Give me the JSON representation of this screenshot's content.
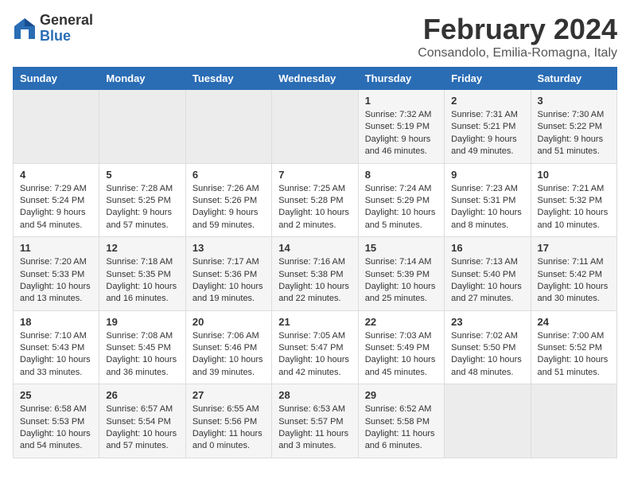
{
  "header": {
    "logo_general": "General",
    "logo_blue": "Blue",
    "month": "February 2024",
    "location": "Consandolo, Emilia-Romagna, Italy"
  },
  "days_of_week": [
    "Sunday",
    "Monday",
    "Tuesday",
    "Wednesday",
    "Thursday",
    "Friday",
    "Saturday"
  ],
  "weeks": [
    [
      {
        "day": "",
        "info": ""
      },
      {
        "day": "",
        "info": ""
      },
      {
        "day": "",
        "info": ""
      },
      {
        "day": "",
        "info": ""
      },
      {
        "day": "1",
        "info": "Sunrise: 7:32 AM\nSunset: 5:19 PM\nDaylight: 9 hours\nand 46 minutes."
      },
      {
        "day": "2",
        "info": "Sunrise: 7:31 AM\nSunset: 5:21 PM\nDaylight: 9 hours\nand 49 minutes."
      },
      {
        "day": "3",
        "info": "Sunrise: 7:30 AM\nSunset: 5:22 PM\nDaylight: 9 hours\nand 51 minutes."
      }
    ],
    [
      {
        "day": "4",
        "info": "Sunrise: 7:29 AM\nSunset: 5:24 PM\nDaylight: 9 hours\nand 54 minutes."
      },
      {
        "day": "5",
        "info": "Sunrise: 7:28 AM\nSunset: 5:25 PM\nDaylight: 9 hours\nand 57 minutes."
      },
      {
        "day": "6",
        "info": "Sunrise: 7:26 AM\nSunset: 5:26 PM\nDaylight: 9 hours\nand 59 minutes."
      },
      {
        "day": "7",
        "info": "Sunrise: 7:25 AM\nSunset: 5:28 PM\nDaylight: 10 hours\nand 2 minutes."
      },
      {
        "day": "8",
        "info": "Sunrise: 7:24 AM\nSunset: 5:29 PM\nDaylight: 10 hours\nand 5 minutes."
      },
      {
        "day": "9",
        "info": "Sunrise: 7:23 AM\nSunset: 5:31 PM\nDaylight: 10 hours\nand 8 minutes."
      },
      {
        "day": "10",
        "info": "Sunrise: 7:21 AM\nSunset: 5:32 PM\nDaylight: 10 hours\nand 10 minutes."
      }
    ],
    [
      {
        "day": "11",
        "info": "Sunrise: 7:20 AM\nSunset: 5:33 PM\nDaylight: 10 hours\nand 13 minutes."
      },
      {
        "day": "12",
        "info": "Sunrise: 7:18 AM\nSunset: 5:35 PM\nDaylight: 10 hours\nand 16 minutes."
      },
      {
        "day": "13",
        "info": "Sunrise: 7:17 AM\nSunset: 5:36 PM\nDaylight: 10 hours\nand 19 minutes."
      },
      {
        "day": "14",
        "info": "Sunrise: 7:16 AM\nSunset: 5:38 PM\nDaylight: 10 hours\nand 22 minutes."
      },
      {
        "day": "15",
        "info": "Sunrise: 7:14 AM\nSunset: 5:39 PM\nDaylight: 10 hours\nand 25 minutes."
      },
      {
        "day": "16",
        "info": "Sunrise: 7:13 AM\nSunset: 5:40 PM\nDaylight: 10 hours\nand 27 minutes."
      },
      {
        "day": "17",
        "info": "Sunrise: 7:11 AM\nSunset: 5:42 PM\nDaylight: 10 hours\nand 30 minutes."
      }
    ],
    [
      {
        "day": "18",
        "info": "Sunrise: 7:10 AM\nSunset: 5:43 PM\nDaylight: 10 hours\nand 33 minutes."
      },
      {
        "day": "19",
        "info": "Sunrise: 7:08 AM\nSunset: 5:45 PM\nDaylight: 10 hours\nand 36 minutes."
      },
      {
        "day": "20",
        "info": "Sunrise: 7:06 AM\nSunset: 5:46 PM\nDaylight: 10 hours\nand 39 minutes."
      },
      {
        "day": "21",
        "info": "Sunrise: 7:05 AM\nSunset: 5:47 PM\nDaylight: 10 hours\nand 42 minutes."
      },
      {
        "day": "22",
        "info": "Sunrise: 7:03 AM\nSunset: 5:49 PM\nDaylight: 10 hours\nand 45 minutes."
      },
      {
        "day": "23",
        "info": "Sunrise: 7:02 AM\nSunset: 5:50 PM\nDaylight: 10 hours\nand 48 minutes."
      },
      {
        "day": "24",
        "info": "Sunrise: 7:00 AM\nSunset: 5:52 PM\nDaylight: 10 hours\nand 51 minutes."
      }
    ],
    [
      {
        "day": "25",
        "info": "Sunrise: 6:58 AM\nSunset: 5:53 PM\nDaylight: 10 hours\nand 54 minutes."
      },
      {
        "day": "26",
        "info": "Sunrise: 6:57 AM\nSunset: 5:54 PM\nDaylight: 10 hours\nand 57 minutes."
      },
      {
        "day": "27",
        "info": "Sunrise: 6:55 AM\nSunset: 5:56 PM\nDaylight: 11 hours\nand 0 minutes."
      },
      {
        "day": "28",
        "info": "Sunrise: 6:53 AM\nSunset: 5:57 PM\nDaylight: 11 hours\nand 3 minutes."
      },
      {
        "day": "29",
        "info": "Sunrise: 6:52 AM\nSunset: 5:58 PM\nDaylight: 11 hours\nand 6 minutes."
      },
      {
        "day": "",
        "info": ""
      },
      {
        "day": "",
        "info": ""
      }
    ]
  ]
}
